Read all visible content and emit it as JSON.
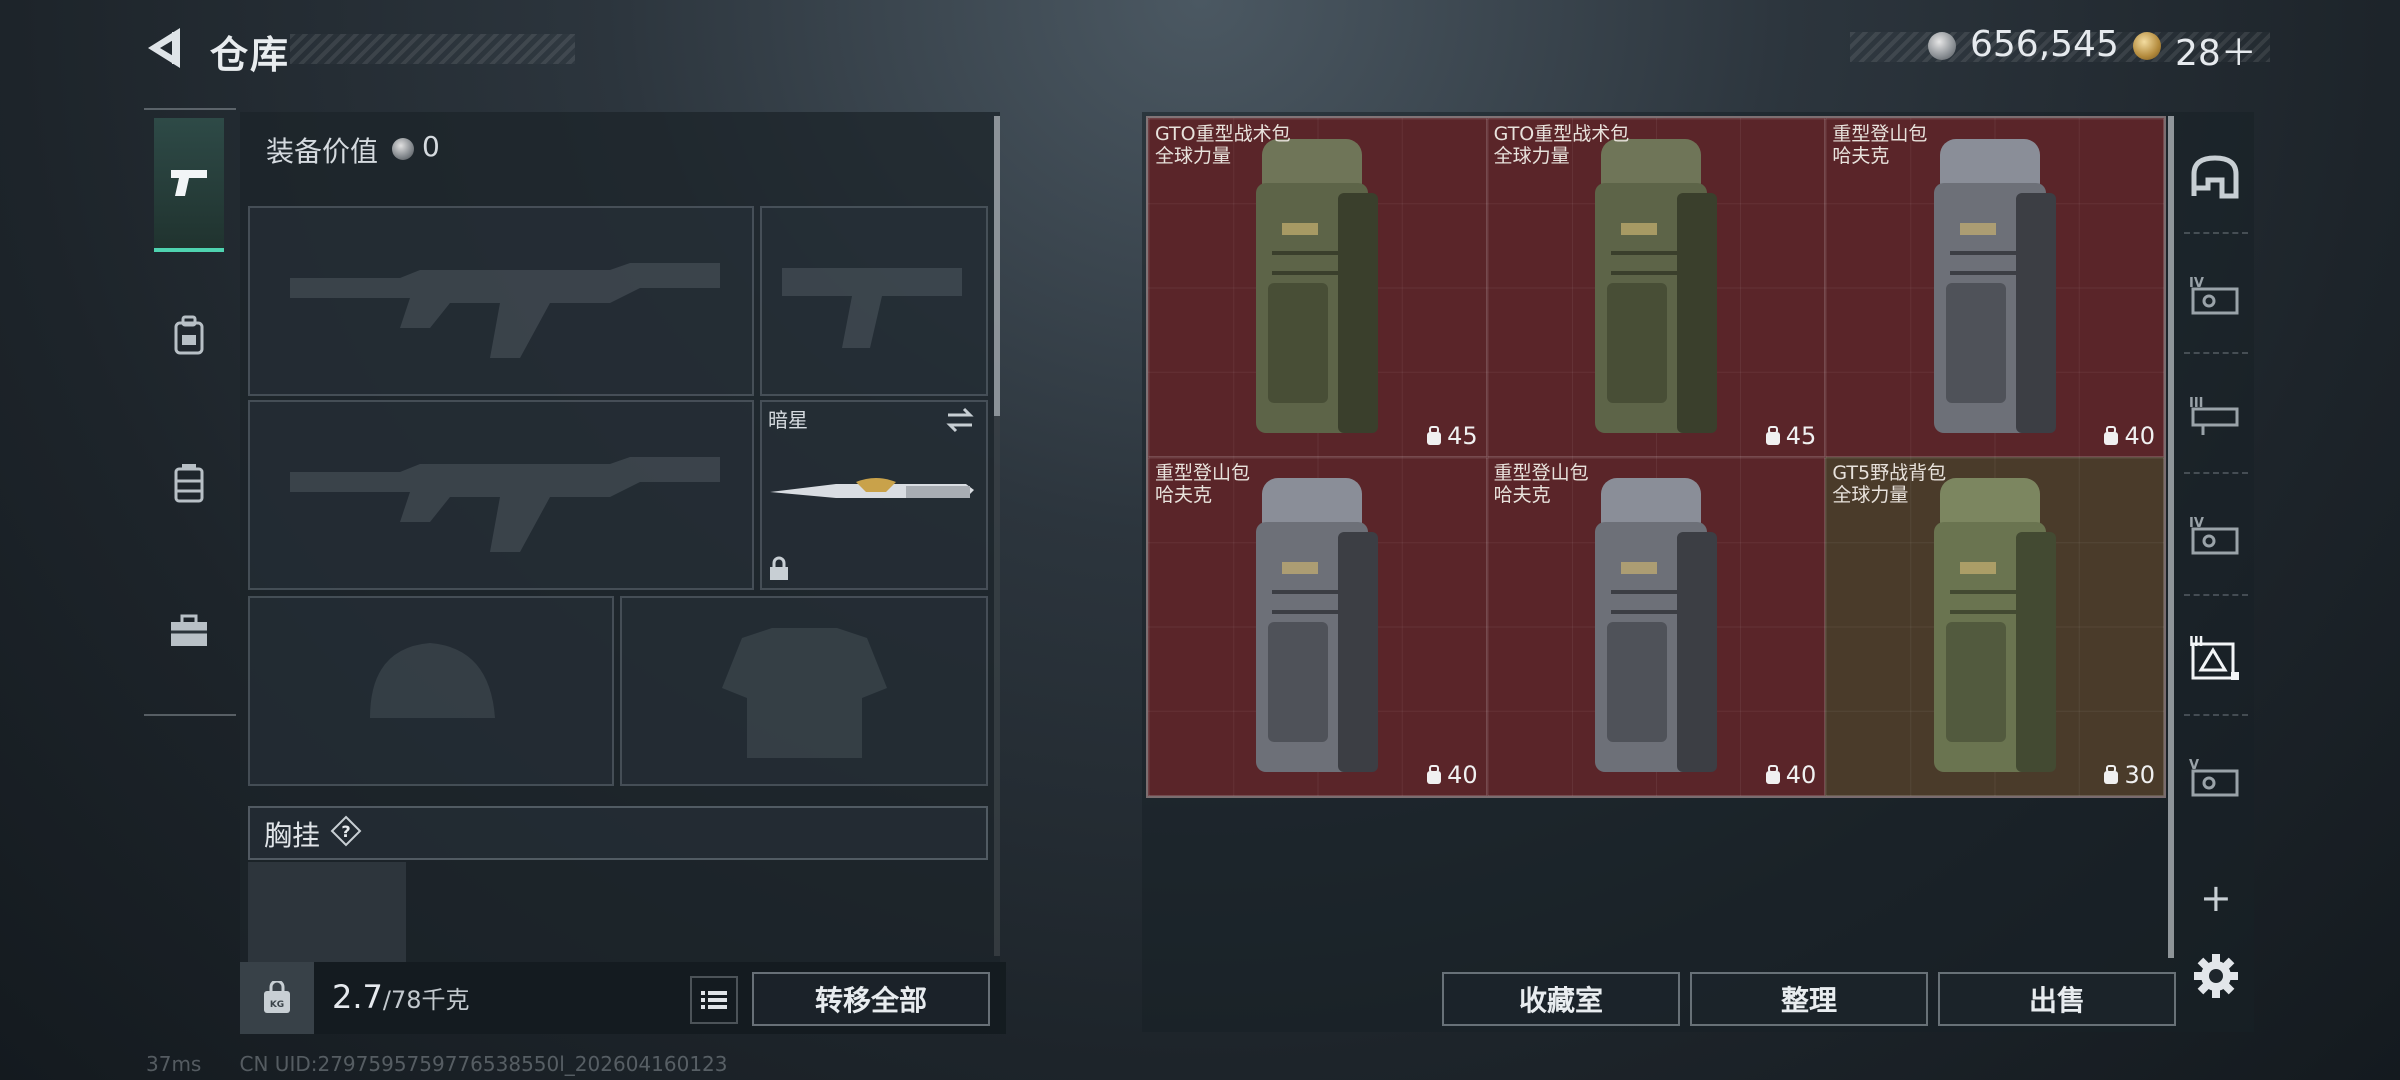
{
  "header": {
    "title": "仓库",
    "currency_amount": "656,545",
    "tickets": "28＋"
  },
  "left_tabs": [
    "weapons",
    "backpack",
    "vest",
    "kit"
  ],
  "loadout": {
    "value_label": "装备价值",
    "value": "0",
    "melee_name": "暗星",
    "chest_label": "胸挂",
    "help": "?",
    "weight_current": "2.7",
    "weight_max": "/78千克",
    "transfer_all": "转移全部"
  },
  "storage": {
    "items": [
      {
        "line1": "GTO重型战术包",
        "line2": "全球力量",
        "capacity": "45",
        "bg": "#5a2529",
        "color": "olive"
      },
      {
        "line1": "GTO重型战术包",
        "line2": "全球力量",
        "capacity": "45",
        "bg": "#5a2529",
        "color": "olive"
      },
      {
        "line1": "重型登山包",
        "line2": "哈夫克",
        "capacity": "40",
        "bg": "#5a2529",
        "color": "grey"
      },
      {
        "line1": "重型登山包",
        "line2": "哈夫克",
        "capacity": "40",
        "bg": "#5a2529",
        "color": "grey"
      },
      {
        "line1": "重型登山包",
        "line2": "哈夫克",
        "capacity": "40",
        "bg": "#5a2529",
        "color": "grey"
      },
      {
        "line1": "GT5野战背包",
        "line2": "全球力量",
        "capacity": "30",
        "bg": "#4a3b2a",
        "color": "green"
      }
    ],
    "collection_btn": "收藏室",
    "sort_btn": "整理",
    "sell_btn": "出售"
  },
  "right_categories": [
    "helmet-tier",
    "IV",
    "III",
    "IV",
    "III",
    "V"
  ],
  "status": {
    "ping": "37ms",
    "uid": "CN UID:2797595759776538550l_202604160123"
  },
  "colors": {
    "accent": "#4fd3b0",
    "red_cell": "#5a2529",
    "tan_cell": "#4a3b2a"
  }
}
